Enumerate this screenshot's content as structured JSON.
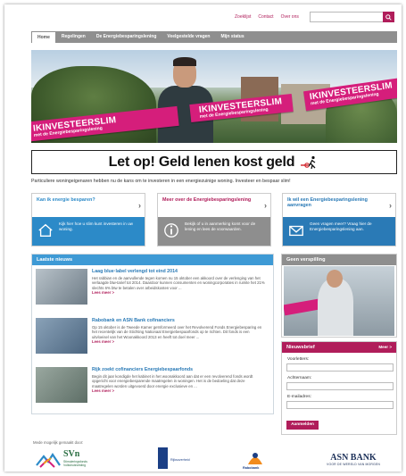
{
  "toplinks": [
    "Zoeklijst",
    "Contact",
    "Over ons"
  ],
  "search": {
    "placeholder": ""
  },
  "nav": [
    "Home",
    "Regelingen",
    "De Energiebesparingslening",
    "Veelgestelde vragen",
    "Mijn status"
  ],
  "banner": {
    "sash_main": "IKINVESTEERSLIM",
    "sash_sub": "met de Energiebesparingslening"
  },
  "warning": "Let op! Geld lenen kost geld",
  "intro": "Particuliere woningeigenaren hebben nu de kans om te investeren in een energiezuinige woning. Investeer en bespaar slim!",
  "boxes": [
    {
      "title": "Kan ik energie besparen?",
      "text": "Kijk hier hoe u slim kunt investeren in uw woning."
    },
    {
      "title": "Meer over de Energiebesparingslening",
      "text": "Bekijk of u in aanmerking komt voor de lening en lees de voorwaarden."
    },
    {
      "title": "Ik wil een Energiebesparingslening aanvragen",
      "text": "Geen vragen meer? Vraag hier de Energiebesparingslening aan."
    }
  ],
  "news": {
    "header": "Laatste nieuws",
    "items": [
      {
        "title": "Laag blue·label verlengd tot eind 2014",
        "text": "Het rabbian en de aanvullende tegen komen nu 15 oktober een akkoord over de verlenging van het verlaagde btw-tarief tot 2014. Daardoor kunnen consumenten en woningcorporaties in ruimte het 21% slechts 6% btw te betalen over arbeidskosten voor ...",
        "more": "Lees meer >"
      },
      {
        "title": "Rabobank en ASN Bank cofinanciers",
        "text": "Op 15 oktober is de Tweede Kamer geïnformeerd over het Revolverend Fonds Energiebesparing en het recentelijk van de Stichting Nationaal Energiebespaarfonds op te richten. Dit fonds is een uitvloeisel van het Woonakkoord 2013 en heeft tot doel meer ...",
        "more": "Lees meer >"
      },
      {
        "title": "Rijk zoekt cofinanciers Energiebespaarfonds",
        "text": "Begin dit jaar kondigde het kabinet in het woonakkoord aan dat er een revolverend fonds wordt opgericht voor energiebesparende maatregelen in woningen. Het is de bedoeling dat deze maatregelen worden uitgevoerd door energie exclusieve en ...",
        "more": "Lees meer >"
      }
    ]
  },
  "video": {
    "header": "Geen verspilling"
  },
  "newsletter": {
    "header": "Nieuwsbrief",
    "more": "Meer >",
    "fields": [
      "Voorletters:",
      "Achternaam:",
      "E-mailadres:"
    ],
    "submit": "Aanmelden"
  },
  "footer": {
    "label": "Mede mogelijk gemaakt door:",
    "svn_word": "SVn",
    "svn_sub": "Stimuleringsfonds Volkshuisvesting",
    "rijk_sub": "Rijksoverheid",
    "rabo_sub": "Rabobank",
    "asn_word": "ASN BANK",
    "asn_sub": "VOOR DE WERELD VAN MORGEN"
  },
  "colors": {
    "magenta": "#b01d5a",
    "pink": "#d51e7b",
    "blue": "#2c8ac8",
    "grey": "#8e8e8e"
  }
}
